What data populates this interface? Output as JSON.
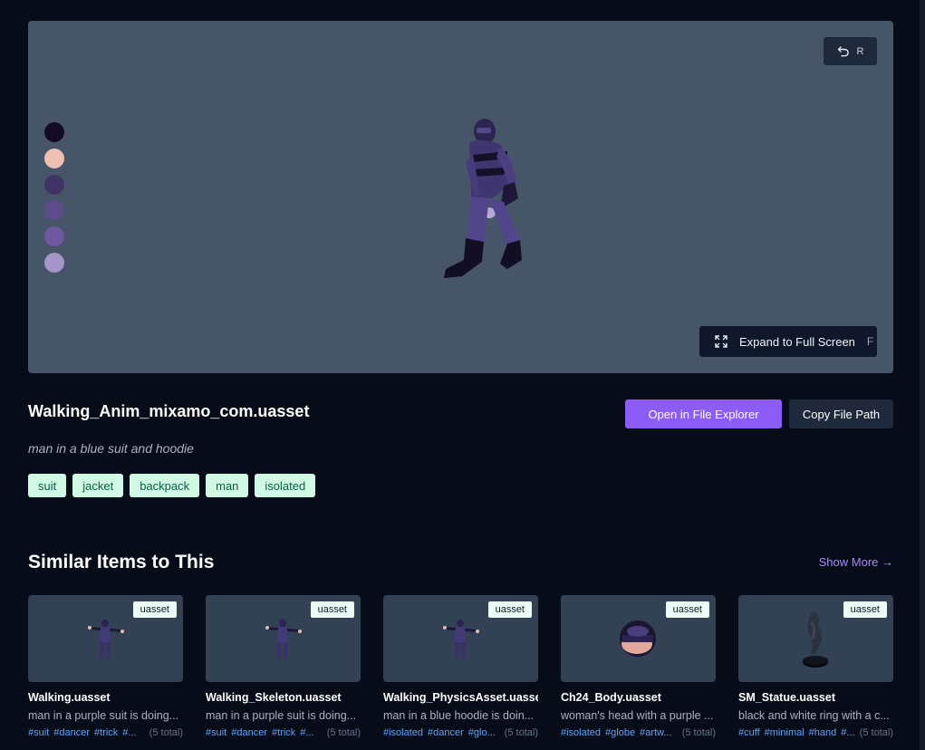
{
  "viewer": {
    "reset_key": "R",
    "expand_label": "Expand to Full Screen",
    "expand_key": "F",
    "swatches": [
      "#140c26",
      "#eec0b2",
      "#3f3465",
      "#5f4a8b",
      "#6f58a0",
      "#a695c8"
    ]
  },
  "asset": {
    "title": "Walking_Anim_mixamo_com.uasset",
    "description": "man in a blue suit and hoodie",
    "tags": [
      "suit",
      "jacket",
      "backpack",
      "man",
      "isolated"
    ]
  },
  "actions": {
    "open_label": "Open in File Explorer",
    "copy_label": "Copy File Path"
  },
  "similar": {
    "heading": "Similar Items to This",
    "show_more": "Show More →",
    "items": [
      {
        "badge": "uasset",
        "name": "Walking.uasset",
        "desc": "man in a purple suit is doing...",
        "tags": [
          "#suit",
          "#dancer",
          "#trick"
        ],
        "more": "#...",
        "total": "(5 total)"
      },
      {
        "badge": "uasset",
        "name": "Walking_Skeleton.uasset",
        "desc": "man in a purple suit is doing...",
        "tags": [
          "#suit",
          "#dancer",
          "#trick"
        ],
        "more": "#...",
        "total": "(5 total)"
      },
      {
        "badge": "uasset",
        "name": "Walking_PhysicsAsset.uasset",
        "desc": "man in a blue hoodie is doin...",
        "tags": [
          "#isolated",
          "#dancer"
        ],
        "more": "#glo...",
        "total": "(5 total)"
      },
      {
        "badge": "uasset",
        "name": "Ch24_Body.uasset",
        "desc": "woman's head with a purple ...",
        "tags": [
          "#isolated",
          "#globe"
        ],
        "more": "#artw...",
        "total": "(5 total)"
      },
      {
        "badge": "uasset",
        "name": "SM_Statue.uasset",
        "desc": "black and white ring with a c...",
        "tags": [
          "#cuff",
          "#minimal",
          "#hand"
        ],
        "more": "#...",
        "total": "(5 total)"
      }
    ]
  }
}
